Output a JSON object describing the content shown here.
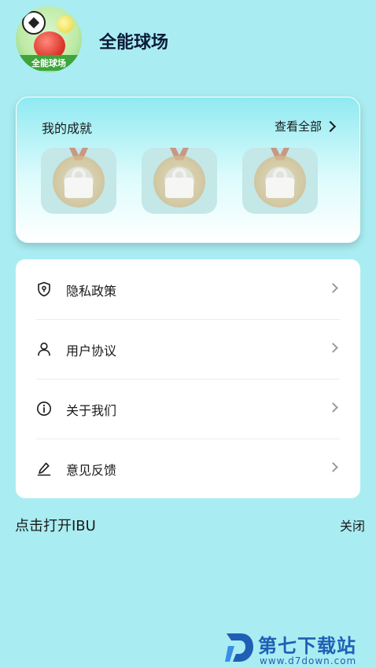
{
  "header": {
    "logo_caption": "全能球场",
    "title": "全能球场"
  },
  "achievements": {
    "title": "我的成就",
    "view_all": "查看全部",
    "medals": [
      {
        "state": "locked"
      },
      {
        "state": "locked"
      },
      {
        "state": "locked"
      }
    ]
  },
  "menu": {
    "items": [
      {
        "label": "隐私政策",
        "icon": "privacy-shield-icon"
      },
      {
        "label": "用户协议",
        "icon": "user-icon"
      },
      {
        "label": "关于我们",
        "icon": "info-icon"
      },
      {
        "label": "意见反馈",
        "icon": "edit-pen-icon"
      }
    ]
  },
  "footer": {
    "ibu_text": "点击打开IBU",
    "close_text": "关闭"
  },
  "watermark": {
    "name": "第七下载站",
    "url": "www.d7down.com"
  },
  "colors": {
    "background": "#a9edf2",
    "card": "#ffffff",
    "title_text": "#0d1a3a",
    "watermark": "#1f5fb5"
  }
}
